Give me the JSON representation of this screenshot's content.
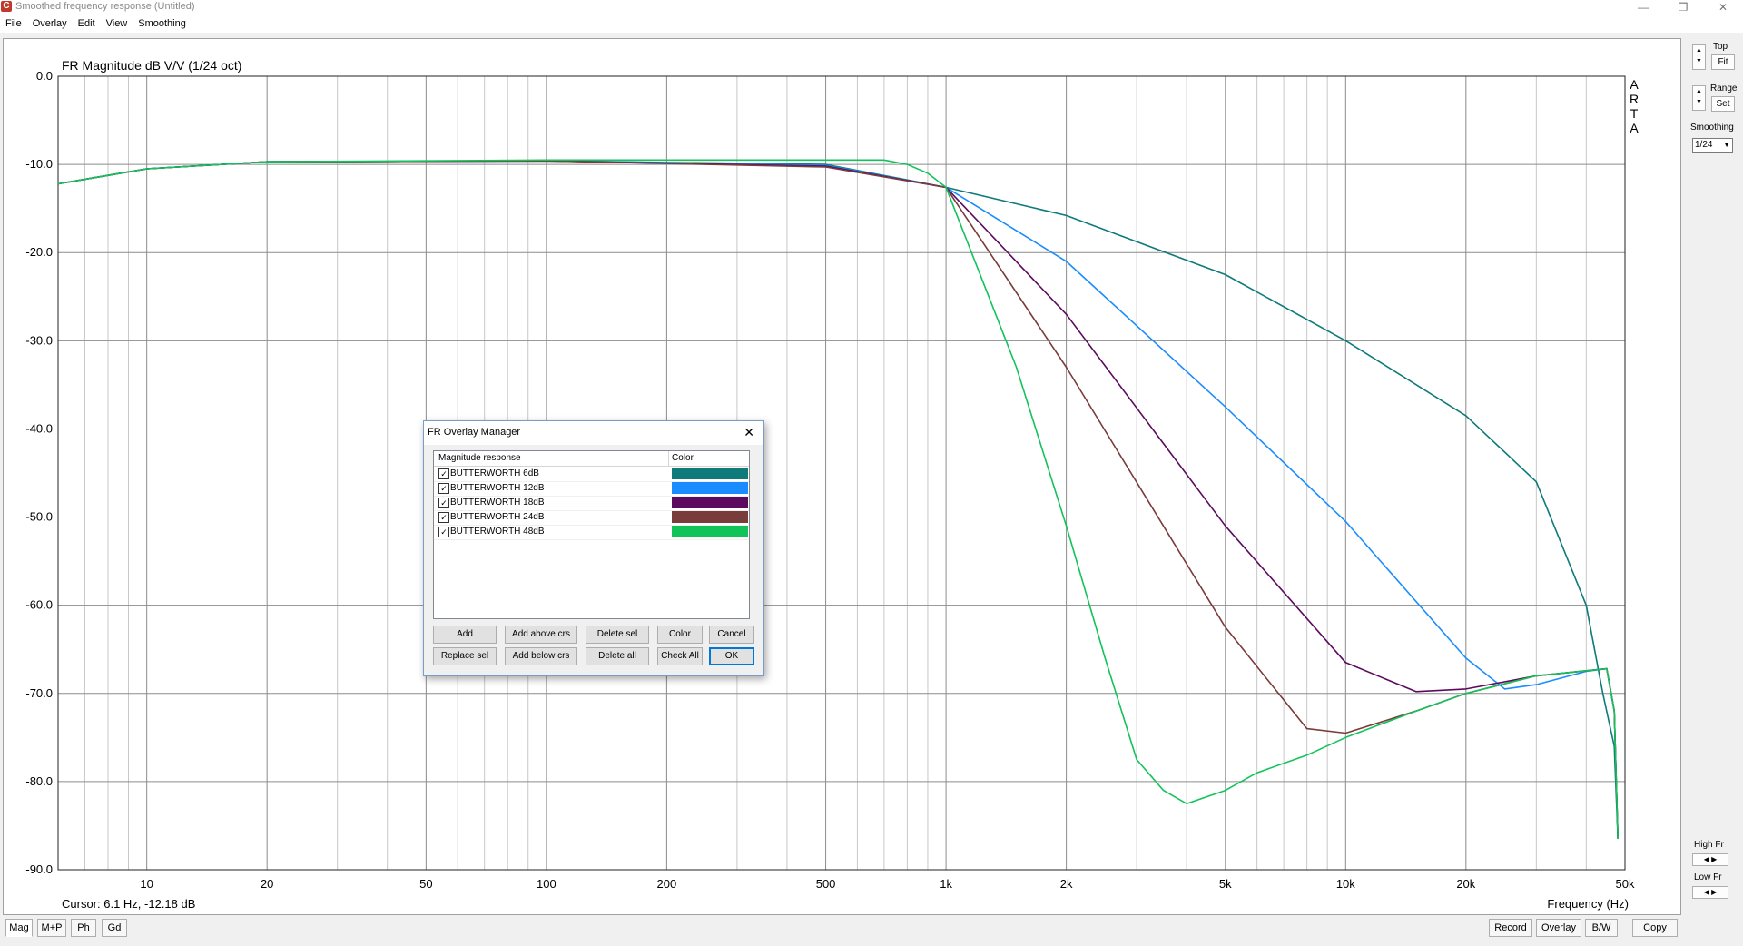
{
  "window": {
    "title": "Smoothed frequency response (Untitled)",
    "controls": {
      "minimize": "—",
      "restore": "❐",
      "close": "✕"
    }
  },
  "menu": [
    "File",
    "Overlay",
    "Edit",
    "View",
    "Smoothing"
  ],
  "arta_logo": "ARTA",
  "cursor_readout": "Cursor: 6.1 Hz, -12.18 dB",
  "right_panel": {
    "top_label": "Top",
    "fit_label": "Fit",
    "range_label": "Range",
    "set_label": "Set",
    "smoothing_label": "Smoothing",
    "smoothing_value": "1/24",
    "high_fr_label": "High Fr",
    "low_fr_label": "Low Fr"
  },
  "bottom_tabs": [
    "Mag",
    "M+P",
    "Ph",
    "Gd"
  ],
  "bottom_buttons": [
    "Record",
    "Overlay",
    "B/W",
    "Copy"
  ],
  "overlay_dialog": {
    "title": "FR Overlay Manager",
    "col_response": "Magnitude response",
    "col_color": "Color",
    "items": [
      {
        "name": "BUTTERWORTH 6dB",
        "checked": true,
        "color": "#0e7a7a"
      },
      {
        "name": "BUTTERWORTH 12dB",
        "checked": true,
        "color": "#1a8cff"
      },
      {
        "name": "BUTTERWORTH 18dB",
        "checked": true,
        "color": "#5c0a5e"
      },
      {
        "name": "BUTTERWORTH 24dB",
        "checked": true,
        "color": "#7a3b3b"
      },
      {
        "name": "BUTTERWORTH 48dB",
        "checked": true,
        "color": "#12c35a"
      }
    ],
    "buttons_row1": [
      "Add",
      "Add above crs",
      "Delete sel",
      "Color",
      "Cancel"
    ],
    "buttons_row2": [
      "Replace sel",
      "Add below crs",
      "Delete all",
      "Check All",
      "OK"
    ]
  },
  "chart_data": {
    "type": "line",
    "title": "FR Magnitude dB V/V (1/24 oct)",
    "xlabel": "Frequency (Hz)",
    "ylabel": "",
    "x_scale": "log",
    "xlim": [
      6,
      50000
    ],
    "ylim": [
      -90,
      0
    ],
    "x_ticks": [
      10,
      20,
      50,
      100,
      200,
      500,
      1000,
      2000,
      5000,
      10000,
      20000,
      50000
    ],
    "x_tick_labels": [
      "10",
      "20",
      "50",
      "100",
      "200",
      "500",
      "1k",
      "2k",
      "5k",
      "10k",
      "20k",
      "50k"
    ],
    "y_ticks": [
      0,
      -10,
      -20,
      -30,
      -40,
      -50,
      -60,
      -70,
      -80,
      -90
    ],
    "y_tick_labels": [
      "0.0",
      "-10.0",
      "-20.0",
      "-30.0",
      "-40.0",
      "-50.0",
      "-60.0",
      "-70.0",
      "-80.0",
      "-90.0"
    ],
    "grid": true,
    "series": [
      {
        "name": "BUTTERWORTH 6dB",
        "color": "#0e7a7a",
        "x": [
          6,
          10,
          20,
          100,
          500,
          1000,
          2000,
          5000,
          10000,
          20000,
          30000,
          40000,
          44000,
          47000,
          48000
        ],
        "y": [
          -12.2,
          -10.5,
          -9.7,
          -9.6,
          -10.0,
          -12.6,
          -15.8,
          -22.5,
          -30.0,
          -38.5,
          -46.0,
          -60.0,
          -70.0,
          -76.0,
          -86.5
        ]
      },
      {
        "name": "BUTTERWORTH 12dB",
        "color": "#1a8cff",
        "x": [
          6,
          10,
          20,
          100,
          500,
          1000,
          2000,
          5000,
          10000,
          20000,
          25000,
          30000,
          40000,
          45000,
          47000,
          48000
        ],
        "y": [
          -12.2,
          -10.5,
          -9.7,
          -9.6,
          -10.1,
          -12.6,
          -21.0,
          -37.5,
          -50.5,
          -66.0,
          -69.5,
          -69.0,
          -67.5,
          -67.2,
          -72.0,
          -86.5
        ]
      },
      {
        "name": "BUTTERWORTH 18dB",
        "color": "#5c0a5e",
        "x": [
          6,
          10,
          20,
          100,
          500,
          1000,
          2000,
          5000,
          10000,
          15000,
          20000,
          30000,
          45000,
          47000,
          48000
        ],
        "y": [
          -12.2,
          -10.5,
          -9.7,
          -9.6,
          -10.2,
          -12.6,
          -27.0,
          -51.0,
          -66.5,
          -69.8,
          -69.5,
          -68.0,
          -67.2,
          -72.0,
          -86.5
        ]
      },
      {
        "name": "BUTTERWORTH 24dB",
        "color": "#7a3b3b",
        "x": [
          6,
          10,
          20,
          100,
          500,
          1000,
          2000,
          5000,
          8000,
          10000,
          15000,
          20000,
          30000,
          45000,
          47000,
          48000
        ],
        "y": [
          -12.2,
          -10.5,
          -9.7,
          -9.6,
          -10.3,
          -12.6,
          -33.0,
          -62.5,
          -74.0,
          -74.5,
          -72.0,
          -70.0,
          -68.0,
          -67.2,
          -72.0,
          -86.5
        ]
      },
      {
        "name": "BUTTERWORTH 48dB",
        "color": "#12c35a",
        "x": [
          6,
          10,
          20,
          100,
          700,
          800,
          900,
          1000,
          1500,
          2000,
          2500,
          3000,
          3500,
          4000,
          5000,
          6000,
          8000,
          10000,
          15000,
          20000,
          30000,
          45000,
          47000,
          48000
        ],
        "y": [
          -12.2,
          -10.5,
          -9.7,
          -9.5,
          -9.5,
          -10.0,
          -11.0,
          -12.6,
          -33.0,
          -51.0,
          -66.0,
          -77.5,
          -81.0,
          -82.5,
          -81.0,
          -79.0,
          -77.0,
          -75.0,
          -72.0,
          -70.0,
          -68.0,
          -67.2,
          -72.0,
          -86.5
        ]
      }
    ]
  }
}
